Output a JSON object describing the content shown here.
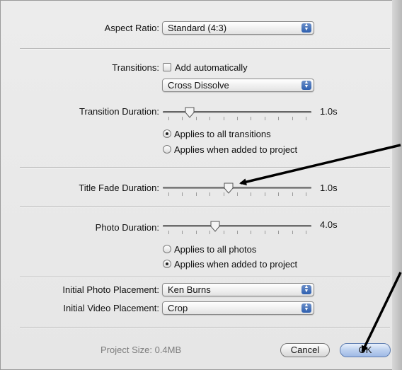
{
  "aspect_ratio": {
    "label": "Aspect Ratio:",
    "value": "Standard (4:3)"
  },
  "transitions": {
    "label": "Transitions:",
    "add_auto_label": "Add automatically",
    "add_auto_checked": false,
    "style_value": "Cross Dissolve"
  },
  "transition_duration": {
    "label": "Transition Duration:",
    "value_text": "1.0s",
    "slider_fraction": 0.16,
    "options": [
      "Applies to all transitions",
      "Applies when added to project"
    ],
    "selected_index": 0
  },
  "title_fade_duration": {
    "label": "Title Fade Duration:",
    "value_text": "1.0s",
    "slider_fraction": 0.44
  },
  "photo_duration": {
    "label": "Photo Duration:",
    "value_text": "4.0s",
    "slider_fraction": 0.34,
    "options": [
      "Applies to all photos",
      "Applies when added to project"
    ],
    "selected_index": 1
  },
  "initial_photo_placement": {
    "label": "Initial Photo Placement:",
    "value": "Ken Burns"
  },
  "initial_video_placement": {
    "label": "Initial Video Placement:",
    "value": "Crop"
  },
  "footer": {
    "project_size": "Project Size: 0.4MB",
    "cancel_label": "Cancel",
    "ok_label": "OK"
  },
  "colors": {
    "accent": "#3a6bc4",
    "annotation_arrow": "#000000"
  }
}
